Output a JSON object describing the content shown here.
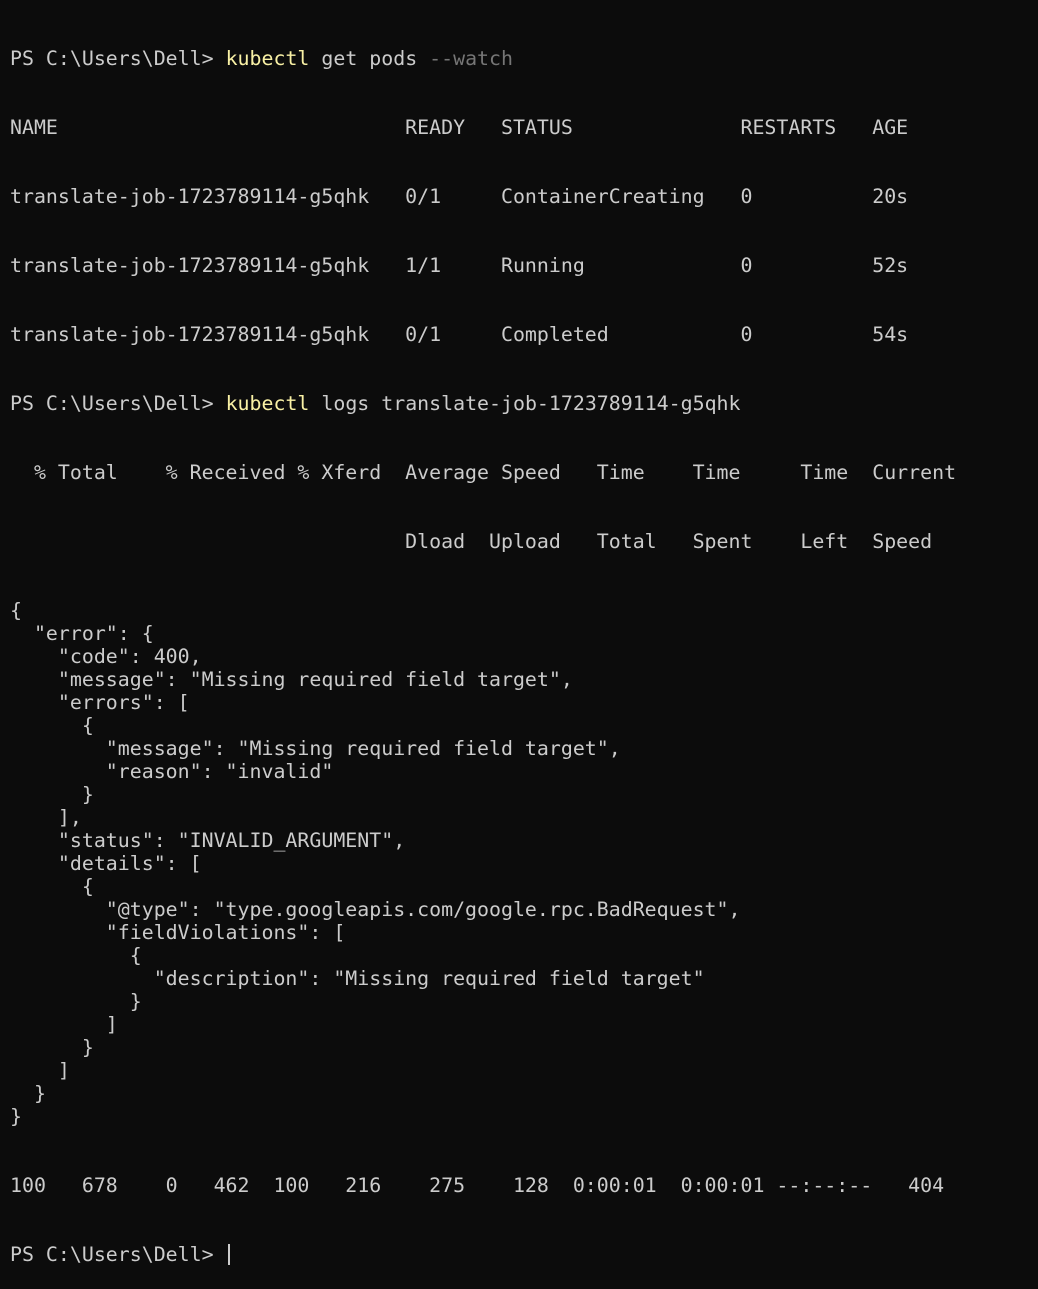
{
  "terminal": {
    "prompt": "PS C:\\Users\\Dell> ",
    "cmd1": {
      "program": "kubectl",
      "args": " get pods ",
      "flag": "--watch"
    },
    "pods_header": "NAME                             READY   STATUS              RESTARTS   AGE",
    "pods_rows": [
      "translate-job-1723789114-g5qhk   0/1     ContainerCreating   0          20s",
      "translate-job-1723789114-g5qhk   1/1     Running             0          52s",
      "translate-job-1723789114-g5qhk   0/1     Completed           0          54s"
    ],
    "cmd2": {
      "program": "kubectl",
      "args": " logs translate-job-1723789114-g5qhk"
    },
    "curl_header_1": "  % Total    % Received % Xferd  Average Speed   Time    Time     Time  Current",
    "curl_header_2": "                                 Dload  Upload   Total   Spent    Left  Speed",
    "json_lines": [
      "{",
      "  \"error\": {",
      "    \"code\": 400,",
      "    \"message\": \"Missing required field target\",",
      "    \"errors\": [",
      "      {",
      "        \"message\": \"Missing required field target\",",
      "        \"reason\": \"invalid\"",
      "      }",
      "    ],",
      "    \"status\": \"INVALID_ARGUMENT\",",
      "    \"details\": [",
      "      {",
      "        \"@type\": \"type.googleapis.com/google.rpc.BadRequest\",",
      "        \"fieldViolations\": [",
      "          {",
      "            \"description\": \"Missing required field target\"",
      "          }",
      "        ]",
      "      }",
      "    ]",
      "  }",
      "}"
    ],
    "curl_progress": "100   678    0   462  100   216    275    128  0:00:01  0:00:01 --:--:--   404",
    "final_prompt": "PS C:\\Users\\Dell> "
  },
  "colors": {
    "background": "#0c0c0c",
    "foreground": "#cccccc",
    "command": "#f9f1a5",
    "flag": "#767676"
  }
}
